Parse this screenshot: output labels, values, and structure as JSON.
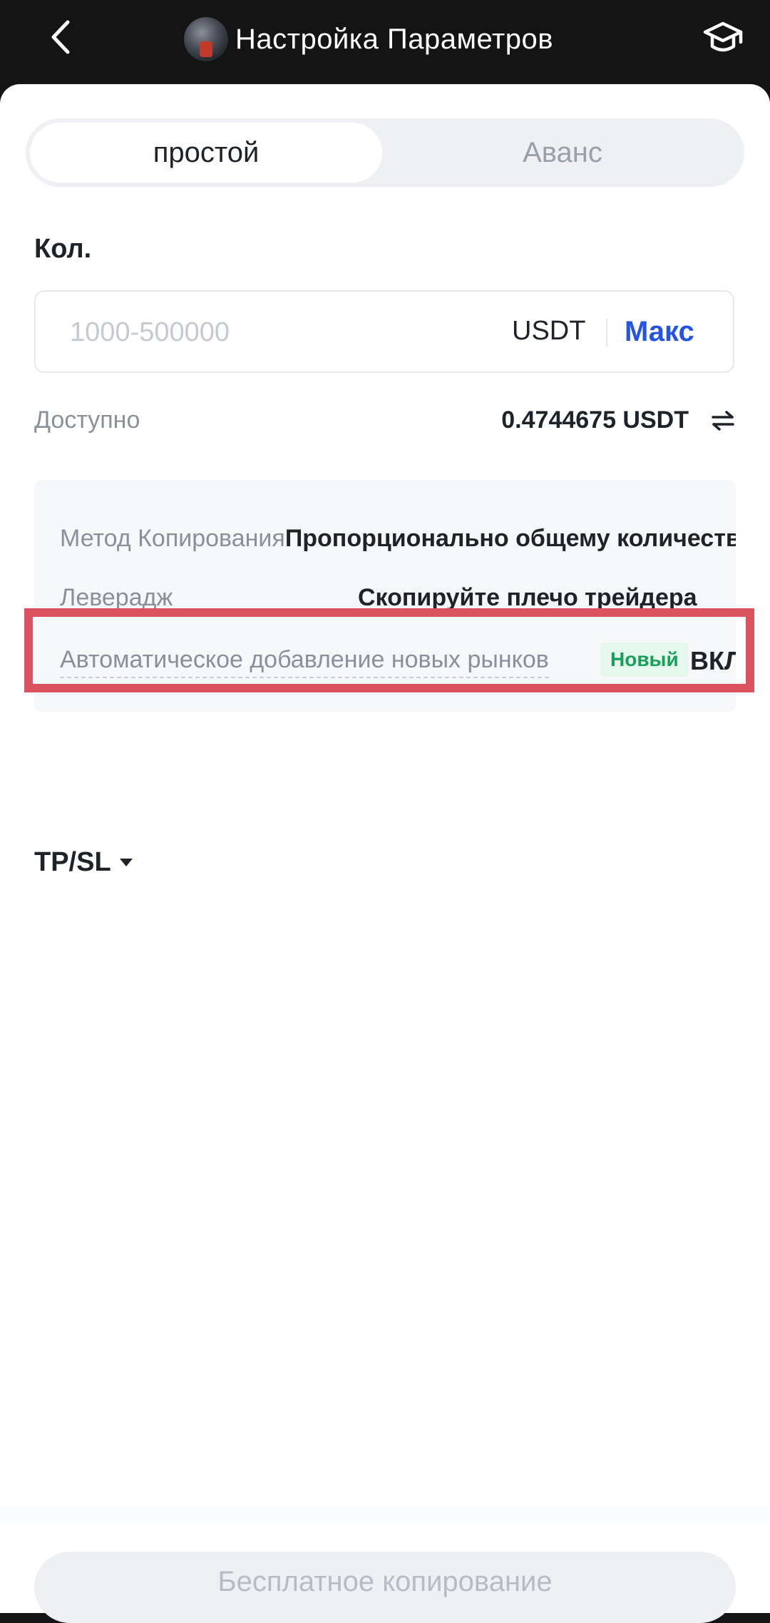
{
  "header": {
    "title": "Настройка Параметров",
    "back_icon": "chevron-left-icon",
    "learn_icon": "graduation-cap-icon"
  },
  "mode_tabs": [
    {
      "label": "простой",
      "active": true
    },
    {
      "label": "Аванс",
      "active": false
    }
  ],
  "quantity": {
    "label": "Кол.",
    "placeholder": "1000-500000",
    "value": "",
    "unit": "USDT",
    "max_label": "Макс"
  },
  "available": {
    "label": "Доступно",
    "value": "0.4744675 USDT",
    "transfer_icon": "swap-arrows-icon"
  },
  "settings": {
    "copy_method_label": "Метод Копирования",
    "copy_method_value": "Пропорционально общему количеству",
    "leverage_label": "Леверадж",
    "leverage_value": "Скопируйте плечо трейдера",
    "auto_add_label": "Автоматическое добавление новых рынков",
    "auto_add_badge": "Новый",
    "auto_add_value": "ВКЛ."
  },
  "tpsl": {
    "label": "TP/SL"
  },
  "cta": {
    "label": "Бесплатное копирование"
  },
  "colors": {
    "accent": "#2354e6",
    "badge_green": "#18a05a",
    "highlight_red": "#d9525e",
    "header_bg": "#141414"
  }
}
